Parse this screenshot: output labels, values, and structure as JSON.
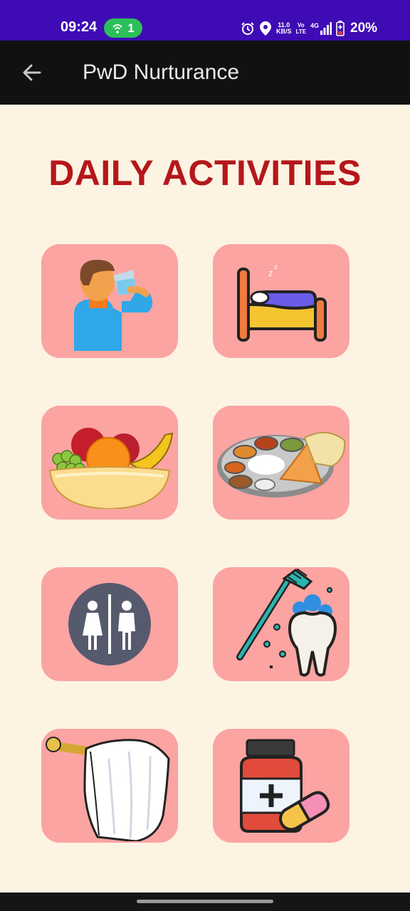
{
  "status_bar": {
    "time": "09:24",
    "hotspot_count": "1",
    "net_speed_value": "11.0",
    "net_speed_unit": "KB/S",
    "volte_top": "Vo",
    "volte_bottom": "LTE",
    "network": "4G",
    "battery_percent": "20%"
  },
  "app_bar": {
    "title": "PwD Nurturance",
    "back_icon": "arrow-back-icon"
  },
  "page": {
    "heading": "DAILY ACTIVITIES"
  },
  "activities": [
    {
      "icon": "drinking-water-icon"
    },
    {
      "icon": "bed-sleep-icon"
    },
    {
      "icon": "fruit-basket-icon"
    },
    {
      "icon": "meal-thali-icon"
    },
    {
      "icon": "restroom-icon"
    },
    {
      "icon": "toothbrush-dental-icon"
    },
    {
      "icon": "towel-bath-icon"
    },
    {
      "icon": "medicine-icon"
    }
  ],
  "colors": {
    "status_bar": "#3e0bb4",
    "app_bar": "#111111",
    "background": "#fdf3e3",
    "heading": "#b5171b",
    "tile": "#fba4a2"
  }
}
